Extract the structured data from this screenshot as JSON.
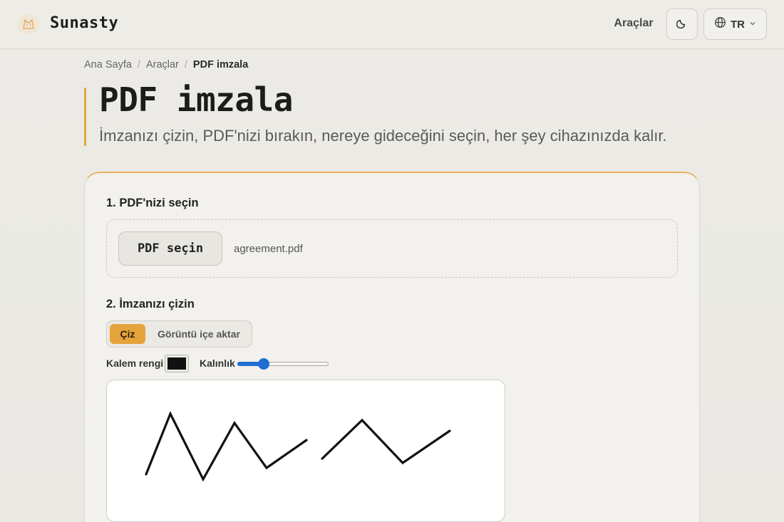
{
  "header": {
    "brand": "Sunasty",
    "nav_tools": "Araçlar",
    "theme_icon": "moon-icon",
    "lang_icon": "globe-icon",
    "lang_label": "TR"
  },
  "breadcrumb": {
    "home": "Ana Sayfa",
    "tools": "Araçlar",
    "current": "PDF imzala"
  },
  "page": {
    "title": "PDF imzala",
    "subtitle": "İmzanızı çizin, PDF'nizi bırakın, nereye gideceğini seçin, her şey cihazınızda kalır."
  },
  "step1": {
    "heading": "1. PDF'nizi seçin",
    "pick_button": "PDF seçin",
    "file_name": "agreement.pdf"
  },
  "step2": {
    "heading": "2. İmzanızı çizin",
    "tab_draw": "Çiz",
    "tab_import": "Görüntü içe aktar",
    "pen_color_label": "Kalem rengi",
    "pen_color": "#111111",
    "thickness_label": "Kalınlık",
    "thickness_fraction": 0.26
  },
  "colors": {
    "accent": "#e5a33c",
    "slider": "#1f6fd1"
  }
}
